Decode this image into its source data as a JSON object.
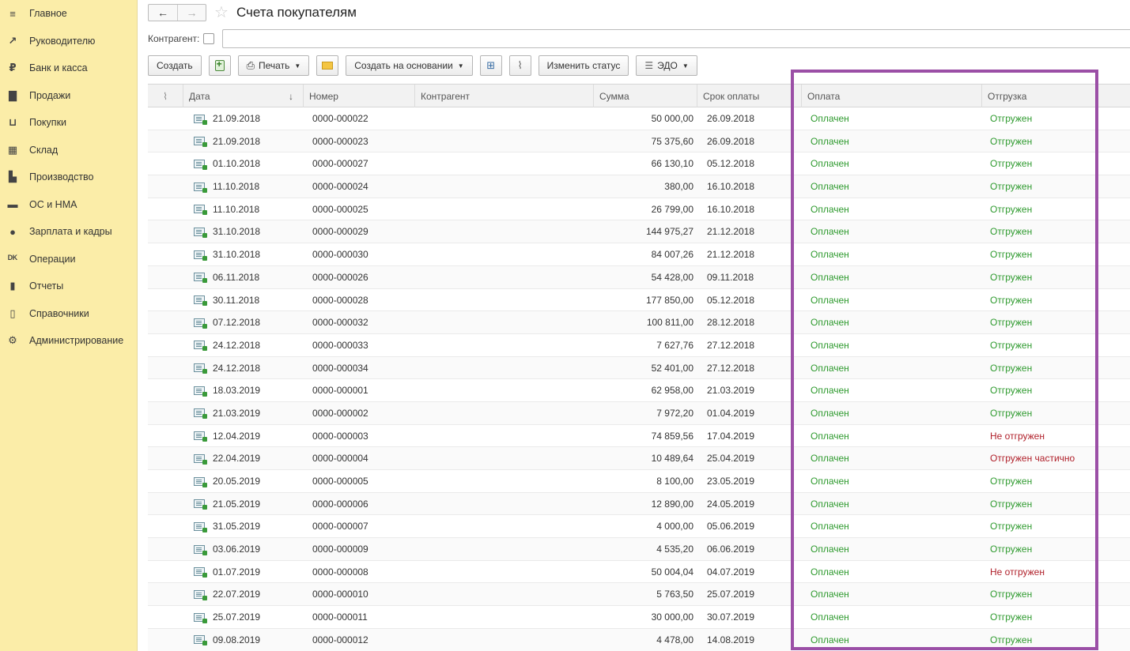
{
  "sidebar": {
    "items": [
      {
        "label": "Главное",
        "icon": "menu-icon",
        "glyph": "≡"
      },
      {
        "label": "Руководителю",
        "icon": "trend-icon",
        "glyph": "↗"
      },
      {
        "label": "Банк и касса",
        "icon": "ruble-icon",
        "glyph": "₽"
      },
      {
        "label": "Продажи",
        "icon": "bag-icon",
        "glyph": "▇"
      },
      {
        "label": "Покупки",
        "icon": "cart-icon",
        "glyph": "⊔"
      },
      {
        "label": "Склад",
        "icon": "warehouse-icon",
        "glyph": "▦"
      },
      {
        "label": "Производство",
        "icon": "factory-icon",
        "glyph": "▙"
      },
      {
        "label": "ОС и НМА",
        "icon": "truck-icon",
        "glyph": "▬"
      },
      {
        "label": "Зарплата и кадры",
        "icon": "person-icon",
        "glyph": "●"
      },
      {
        "label": "Операции",
        "icon": "dt-kt-icon",
        "glyph": "ᴰᴷ"
      },
      {
        "label": "Отчеты",
        "icon": "bar-chart-icon",
        "glyph": "▮"
      },
      {
        "label": "Справочники",
        "icon": "book-icon",
        "glyph": "▯"
      },
      {
        "label": "Администрирование",
        "icon": "gear-icon",
        "glyph": "⚙"
      }
    ]
  },
  "header": {
    "back": "←",
    "forward": "→",
    "star": "☆",
    "title": "Счета покупателям"
  },
  "filter": {
    "label": "Контрагент:"
  },
  "toolbar": {
    "create": "Создать",
    "print": "Печать",
    "create_based": "Создать на основании",
    "change_status": "Изменить статус",
    "edo": "ЭДО"
  },
  "columns": {
    "attach": "",
    "date": "Дата",
    "sort": "↓",
    "number": "Номер",
    "counterparty": "Контрагент",
    "sum": "Сумма",
    "due": "Срок оплаты",
    "payment": "Оплата",
    "shipment": "Отгрузка"
  },
  "colors": {
    "status_ok": "#2e9a2e",
    "status_bad": "#b0202a",
    "highlight": "#9b4fa6",
    "sidebar_bg": "#fbeda8"
  },
  "rows": [
    {
      "date": "21.09.2018",
      "number": "0000-000022",
      "sum": "50 000,00",
      "due": "26.09.2018",
      "payment": "Оплачен",
      "shipment": "Отгружен",
      "ship_ok": true
    },
    {
      "date": "21.09.2018",
      "number": "0000-000023",
      "sum": "75 375,60",
      "due": "26.09.2018",
      "payment": "Оплачен",
      "shipment": "Отгружен",
      "ship_ok": true
    },
    {
      "date": "01.10.2018",
      "number": "0000-000027",
      "sum": "66 130,10",
      "due": "05.12.2018",
      "payment": "Оплачен",
      "shipment": "Отгружен",
      "ship_ok": true
    },
    {
      "date": "11.10.2018",
      "number": "0000-000024",
      "sum": "380,00",
      "due": "16.10.2018",
      "payment": "Оплачен",
      "shipment": "Отгружен",
      "ship_ok": true
    },
    {
      "date": "11.10.2018",
      "number": "0000-000025",
      "sum": "26 799,00",
      "due": "16.10.2018",
      "payment": "Оплачен",
      "shipment": "Отгружен",
      "ship_ok": true
    },
    {
      "date": "31.10.2018",
      "number": "0000-000029",
      "sum": "144 975,27",
      "due": "21.12.2018",
      "payment": "Оплачен",
      "shipment": "Отгружен",
      "ship_ok": true
    },
    {
      "date": "31.10.2018",
      "number": "0000-000030",
      "sum": "84 007,26",
      "due": "21.12.2018",
      "payment": "Оплачен",
      "shipment": "Отгружен",
      "ship_ok": true
    },
    {
      "date": "06.11.2018",
      "number": "0000-000026",
      "sum": "54 428,00",
      "due": "09.11.2018",
      "payment": "Оплачен",
      "shipment": "Отгружен",
      "ship_ok": true
    },
    {
      "date": "30.11.2018",
      "number": "0000-000028",
      "sum": "177 850,00",
      "due": "05.12.2018",
      "payment": "Оплачен",
      "shipment": "Отгружен",
      "ship_ok": true
    },
    {
      "date": "07.12.2018",
      "number": "0000-000032",
      "sum": "100 811,00",
      "due": "28.12.2018",
      "payment": "Оплачен",
      "shipment": "Отгружен",
      "ship_ok": true
    },
    {
      "date": "24.12.2018",
      "number": "0000-000033",
      "sum": "7 627,76",
      "due": "27.12.2018",
      "payment": "Оплачен",
      "shipment": "Отгружен",
      "ship_ok": true
    },
    {
      "date": "24.12.2018",
      "number": "0000-000034",
      "sum": "52 401,00",
      "due": "27.12.2018",
      "payment": "Оплачен",
      "shipment": "Отгружен",
      "ship_ok": true
    },
    {
      "date": "18.03.2019",
      "number": "0000-000001",
      "sum": "62 958,00",
      "due": "21.03.2019",
      "payment": "Оплачен",
      "shipment": "Отгружен",
      "ship_ok": true
    },
    {
      "date": "21.03.2019",
      "number": "0000-000002",
      "sum": "7 972,20",
      "due": "01.04.2019",
      "payment": "Оплачен",
      "shipment": "Отгружен",
      "ship_ok": true
    },
    {
      "date": "12.04.2019",
      "number": "0000-000003",
      "sum": "74 859,56",
      "due": "17.04.2019",
      "payment": "Оплачен",
      "shipment": "Не отгружен",
      "ship_ok": false
    },
    {
      "date": "22.04.2019",
      "number": "0000-000004",
      "sum": "10 489,64",
      "due": "25.04.2019",
      "payment": "Оплачен",
      "shipment": "Отгружен частично",
      "ship_ok": false
    },
    {
      "date": "20.05.2019",
      "number": "0000-000005",
      "sum": "8 100,00",
      "due": "23.05.2019",
      "payment": "Оплачен",
      "shipment": "Отгружен",
      "ship_ok": true
    },
    {
      "date": "21.05.2019",
      "number": "0000-000006",
      "sum": "12 890,00",
      "due": "24.05.2019",
      "payment": "Оплачен",
      "shipment": "Отгружен",
      "ship_ok": true
    },
    {
      "date": "31.05.2019",
      "number": "0000-000007",
      "sum": "4 000,00",
      "due": "05.06.2019",
      "payment": "Оплачен",
      "shipment": "Отгружен",
      "ship_ok": true
    },
    {
      "date": "03.06.2019",
      "number": "0000-000009",
      "sum": "4 535,20",
      "due": "06.06.2019",
      "payment": "Оплачен",
      "shipment": "Отгружен",
      "ship_ok": true
    },
    {
      "date": "01.07.2019",
      "number": "0000-000008",
      "sum": "50 004,04",
      "due": "04.07.2019",
      "payment": "Оплачен",
      "shipment": "Не отгружен",
      "ship_ok": false
    },
    {
      "date": "22.07.2019",
      "number": "0000-000010",
      "sum": "5 763,50",
      "due": "25.07.2019",
      "payment": "Оплачен",
      "shipment": "Отгружен",
      "ship_ok": true
    },
    {
      "date": "25.07.2019",
      "number": "0000-000011",
      "sum": "30 000,00",
      "due": "30.07.2019",
      "payment": "Оплачен",
      "shipment": "Отгружен",
      "ship_ok": true
    },
    {
      "date": "09.08.2019",
      "number": "0000-000012",
      "sum": "4 478,00",
      "due": "14.08.2019",
      "payment": "Оплачен",
      "shipment": "Отгружен",
      "ship_ok": true
    }
  ]
}
